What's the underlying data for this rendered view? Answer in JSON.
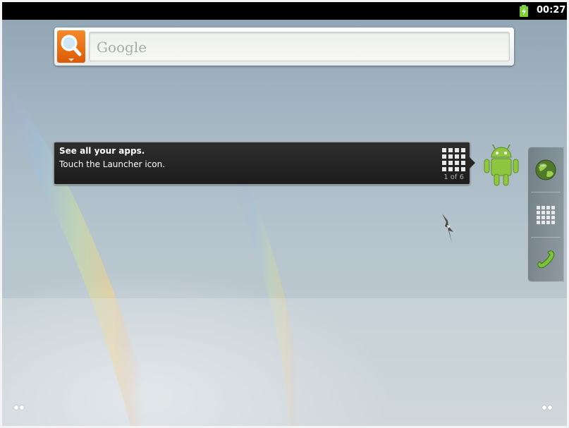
{
  "status_bar": {
    "time": "00:27",
    "battery_icon": "battery-charging-icon",
    "battery_color": "#7bd133"
  },
  "search_widget": {
    "placeholder": "Google",
    "button_icon": "search-icon",
    "button_color": "#ef7a1e"
  },
  "launcher_tip": {
    "title": "See all your apps.",
    "body": "Touch the Launcher icon.",
    "counter": "1 of 6",
    "icon": "launcher-grid-icon"
  },
  "mascot": {
    "icon": "android-robot-icon",
    "color": "#8ec63f"
  },
  "dock": {
    "items": [
      {
        "name": "browser",
        "icon": "globe-icon"
      },
      {
        "name": "launcher",
        "icon": "app-grid-icon"
      },
      {
        "name": "phone",
        "icon": "phone-icon"
      }
    ]
  },
  "wallpaper": {
    "description_icon": "bird-icon"
  },
  "page_indicators": {
    "left_icon": "page-dots-left-icon",
    "right_icon": "page-dots-right-icon"
  }
}
